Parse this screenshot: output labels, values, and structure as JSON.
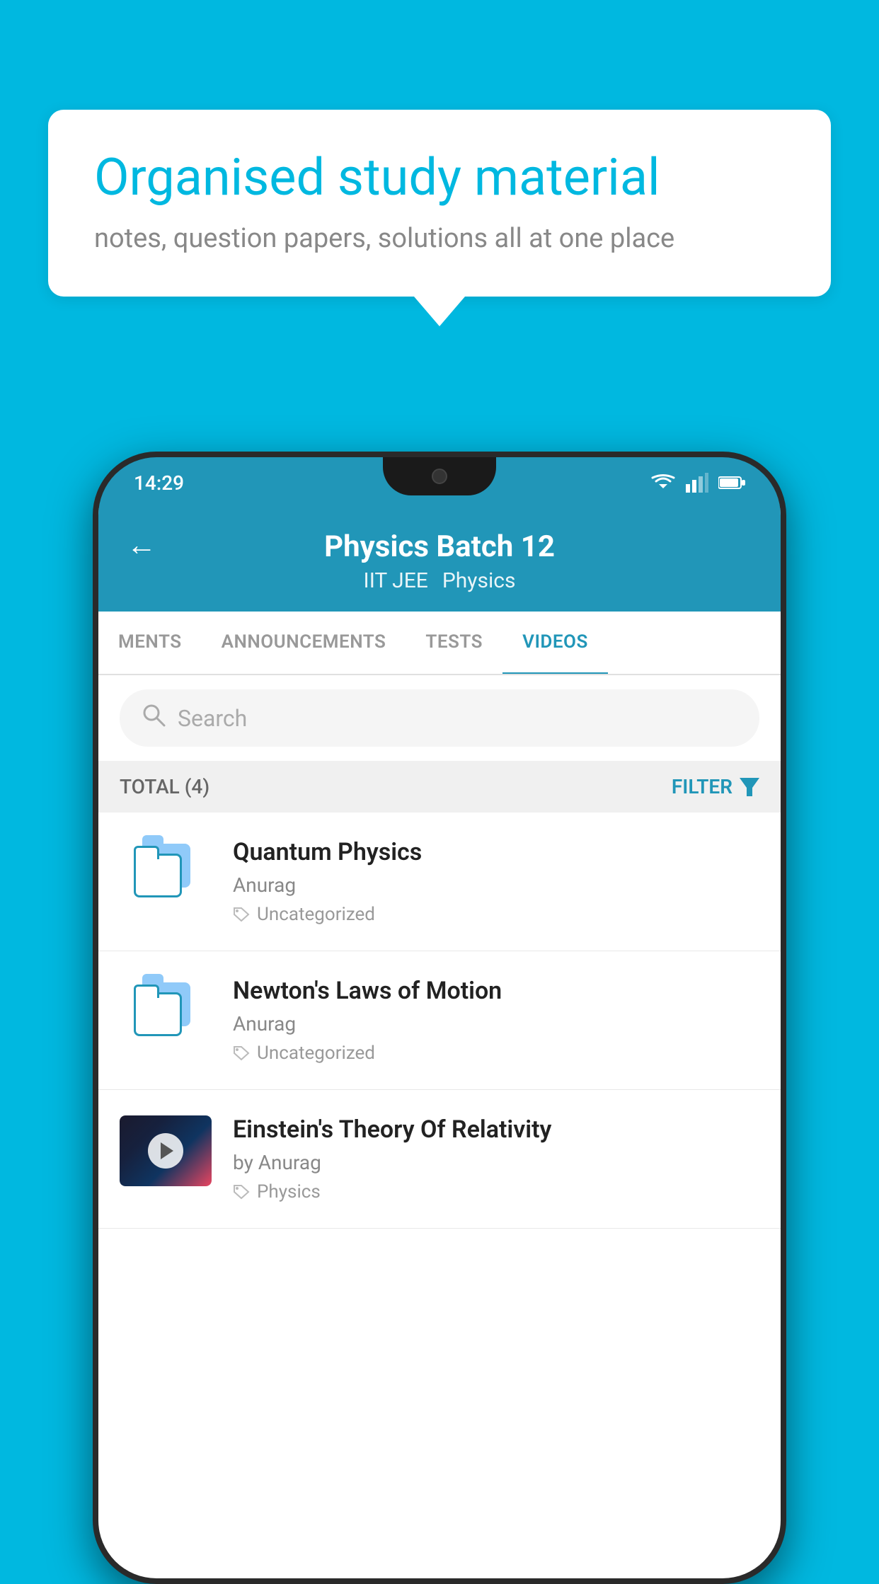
{
  "background": {
    "color": "#00b8e0"
  },
  "speech_bubble": {
    "title": "Organised study material",
    "subtitle": "notes, question papers, solutions all at one place"
  },
  "phone": {
    "status_bar": {
      "time": "14:29"
    },
    "header": {
      "title": "Physics Batch 12",
      "subtitle1": "IIT JEE",
      "subtitle2": "Physics",
      "back_label": "←"
    },
    "tabs": [
      {
        "label": "MENTS",
        "active": false
      },
      {
        "label": "ANNOUNCEMENTS",
        "active": false
      },
      {
        "label": "TESTS",
        "active": false
      },
      {
        "label": "VIDEOS",
        "active": true
      }
    ],
    "search": {
      "placeholder": "Search"
    },
    "filter": {
      "total_label": "TOTAL (4)",
      "filter_label": "FILTER"
    },
    "videos": [
      {
        "id": 1,
        "title": "Quantum Physics",
        "author": "Anurag",
        "tag": "Uncategorized",
        "has_thumbnail": false
      },
      {
        "id": 2,
        "title": "Newton's Laws of Motion",
        "author": "Anurag",
        "tag": "Uncategorized",
        "has_thumbnail": false
      },
      {
        "id": 3,
        "title": "Einstein's Theory Of Relativity",
        "author": "by Anurag",
        "tag": "Physics",
        "has_thumbnail": true
      }
    ]
  }
}
